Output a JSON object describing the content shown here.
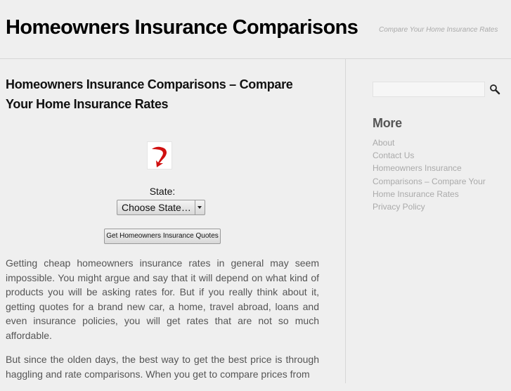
{
  "header": {
    "site_title": "Homeowners Insurance Comparisons",
    "tagline": "Compare Your Home Insurance Rates"
  },
  "main": {
    "post_title": "Homeowners Insurance Comparisons – Compare Your Home Insurance Rates",
    "logo_icon": "red-curved-arrow-icon",
    "form": {
      "state_label": "State:",
      "state_select_value": "Choose State…",
      "submit_label": "Get Homeowners Insurance Quotes"
    },
    "paragraphs": [
      "Getting cheap homeowners insurance rates in general may seem impossible. You might argue and say that it will depend on what kind of products you will be asking rates for. But if you really think about it, getting quotes for a brand new car, a home, travel abroad, loans and even insurance policies, you will get rates that are not so much affordable.",
      "But since the olden days, the best way to get the best price is through haggling and rate comparisons. When you get to compare prices from"
    ]
  },
  "sidebar": {
    "search": {
      "placeholder": "",
      "icon": "search-icon"
    },
    "widget_title": "More",
    "links": [
      "About",
      "Contact Us",
      "Homeowners Insurance Comparisons – Compare Your Home Insurance Rates",
      "Privacy Policy"
    ]
  },
  "colors": {
    "background": "#efefef",
    "title": "#000000",
    "body_text": "#555555",
    "link_muted": "#aaaaaa",
    "logo_red": "#d01010"
  }
}
